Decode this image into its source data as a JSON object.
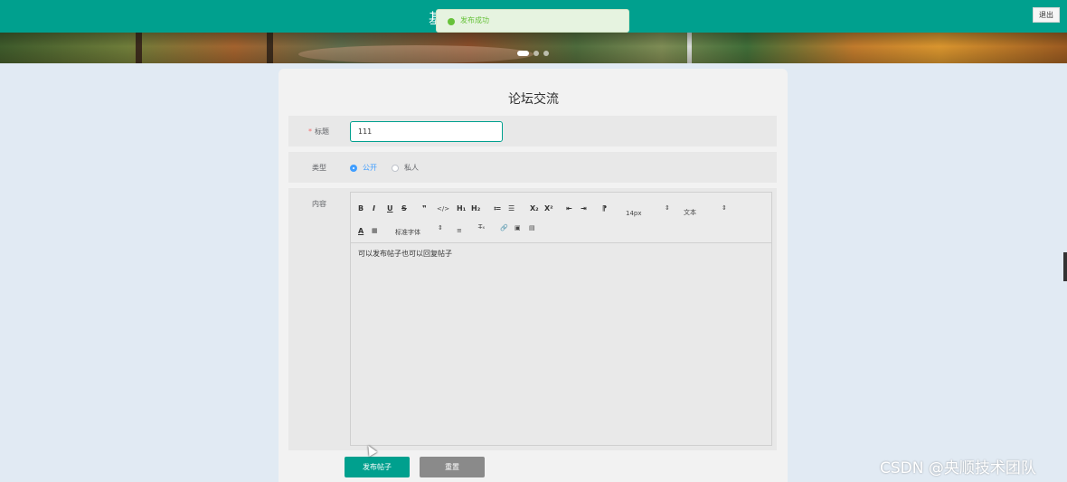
{
  "header": {
    "site_title": "基",
    "logout_label": "退出"
  },
  "toast": {
    "icon": "success-check-icon",
    "message": "发布成功"
  },
  "banner": {
    "slide_count": 3,
    "active_slide": 1
  },
  "form": {
    "title": "论坛交流",
    "title_label": "标题",
    "title_required_mark": "*",
    "title_value": "111",
    "type_label": "类型",
    "type_options": [
      "公开",
      "私人"
    ],
    "type_selected": "公开",
    "content_label": "内容",
    "editor": {
      "toolbar": {
        "bold": "B",
        "italic": "I",
        "underline": "U",
        "strike": "S",
        "blockquote": "❞",
        "code": "</>",
        "h1": "H₁",
        "h2": "H₂",
        "ordered_list": "≔",
        "bullet_list": "☰",
        "subscript": "X₂",
        "superscript": "X²",
        "outdent": "⇤",
        "indent": "⇥",
        "rtl": "⁋",
        "size_value": "14px",
        "header_value": "文本",
        "color": "A",
        "background": "▦",
        "font_value": "标准字体",
        "align": "≡",
        "clean": "T̶ₓ",
        "link": "🔗",
        "image": "▣",
        "video": "▤"
      },
      "content": "可以发布帖子也可以回复帖子"
    },
    "submit_label": "发布帖子",
    "reset_label": "重置"
  },
  "watermark": "CSDN @央顺技术团队",
  "colors": {
    "primary": "#00a08e",
    "page_bg": "#e1eaf3",
    "success": "#67c23a",
    "radio_active": "#409eff"
  }
}
